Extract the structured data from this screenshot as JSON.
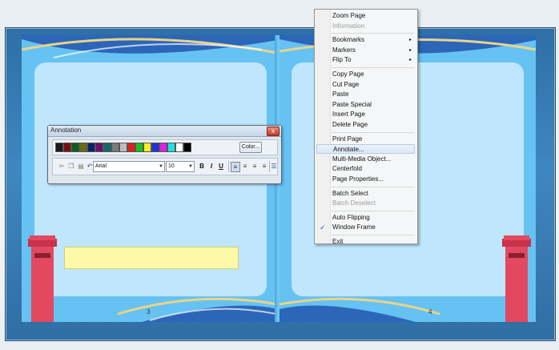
{
  "book": {
    "left_page_number": "3",
    "right_page_number": "4"
  },
  "annotation": {
    "title": "Annotation",
    "close_label": "x",
    "colors": [
      "#1a1a1a",
      "#7a0e0e",
      "#0d5c1f",
      "#6b6b0e",
      "#0e1f6b",
      "#6b0e6b",
      "#0e6b6b",
      "#7a7a7a",
      "#bdbdbd",
      "#e02020",
      "#20c020",
      "#f0f020",
      "#2030e0",
      "#e020e0",
      "#20e0e0",
      "#ffffff",
      "#000000"
    ],
    "color_button": "Color...",
    "font_value": "Arial",
    "size_value": "10",
    "bold": "B",
    "italic": "I",
    "underline": "U"
  },
  "menu": {
    "items": [
      {
        "label": "Zoom Page",
        "disabled": false
      },
      {
        "label": "Information",
        "disabled": true
      },
      {
        "label": "Bookmarks",
        "disabled": false,
        "submenu": true
      },
      {
        "label": "Markers",
        "disabled": false,
        "submenu": true
      },
      {
        "label": "Flip To",
        "disabled": false,
        "submenu": true
      },
      {
        "label": "Copy Page",
        "disabled": false
      },
      {
        "label": "Cut Page",
        "disabled": false
      },
      {
        "label": "Paste",
        "disabled": false
      },
      {
        "label": "Paste Special",
        "disabled": false
      },
      {
        "label": "Insert Page",
        "disabled": false
      },
      {
        "label": "Delete Page",
        "disabled": false
      },
      {
        "label": "Print Page",
        "disabled": false
      },
      {
        "label": "Annotate...",
        "disabled": false,
        "highlighted": true
      },
      {
        "label": "Multi-Media Object...",
        "disabled": false
      },
      {
        "label": "Centerfold",
        "disabled": false
      },
      {
        "label": "Page Properties...",
        "disabled": false
      },
      {
        "label": "Batch Select",
        "disabled": false
      },
      {
        "label": "Batch Deselect",
        "disabled": true
      },
      {
        "label": "Auto Flipping",
        "disabled": false
      },
      {
        "label": "Window Frame",
        "disabled": false,
        "checked": true
      },
      {
        "label": "Exit",
        "disabled": false
      }
    ],
    "arrow": "▸",
    "check": "✓"
  }
}
